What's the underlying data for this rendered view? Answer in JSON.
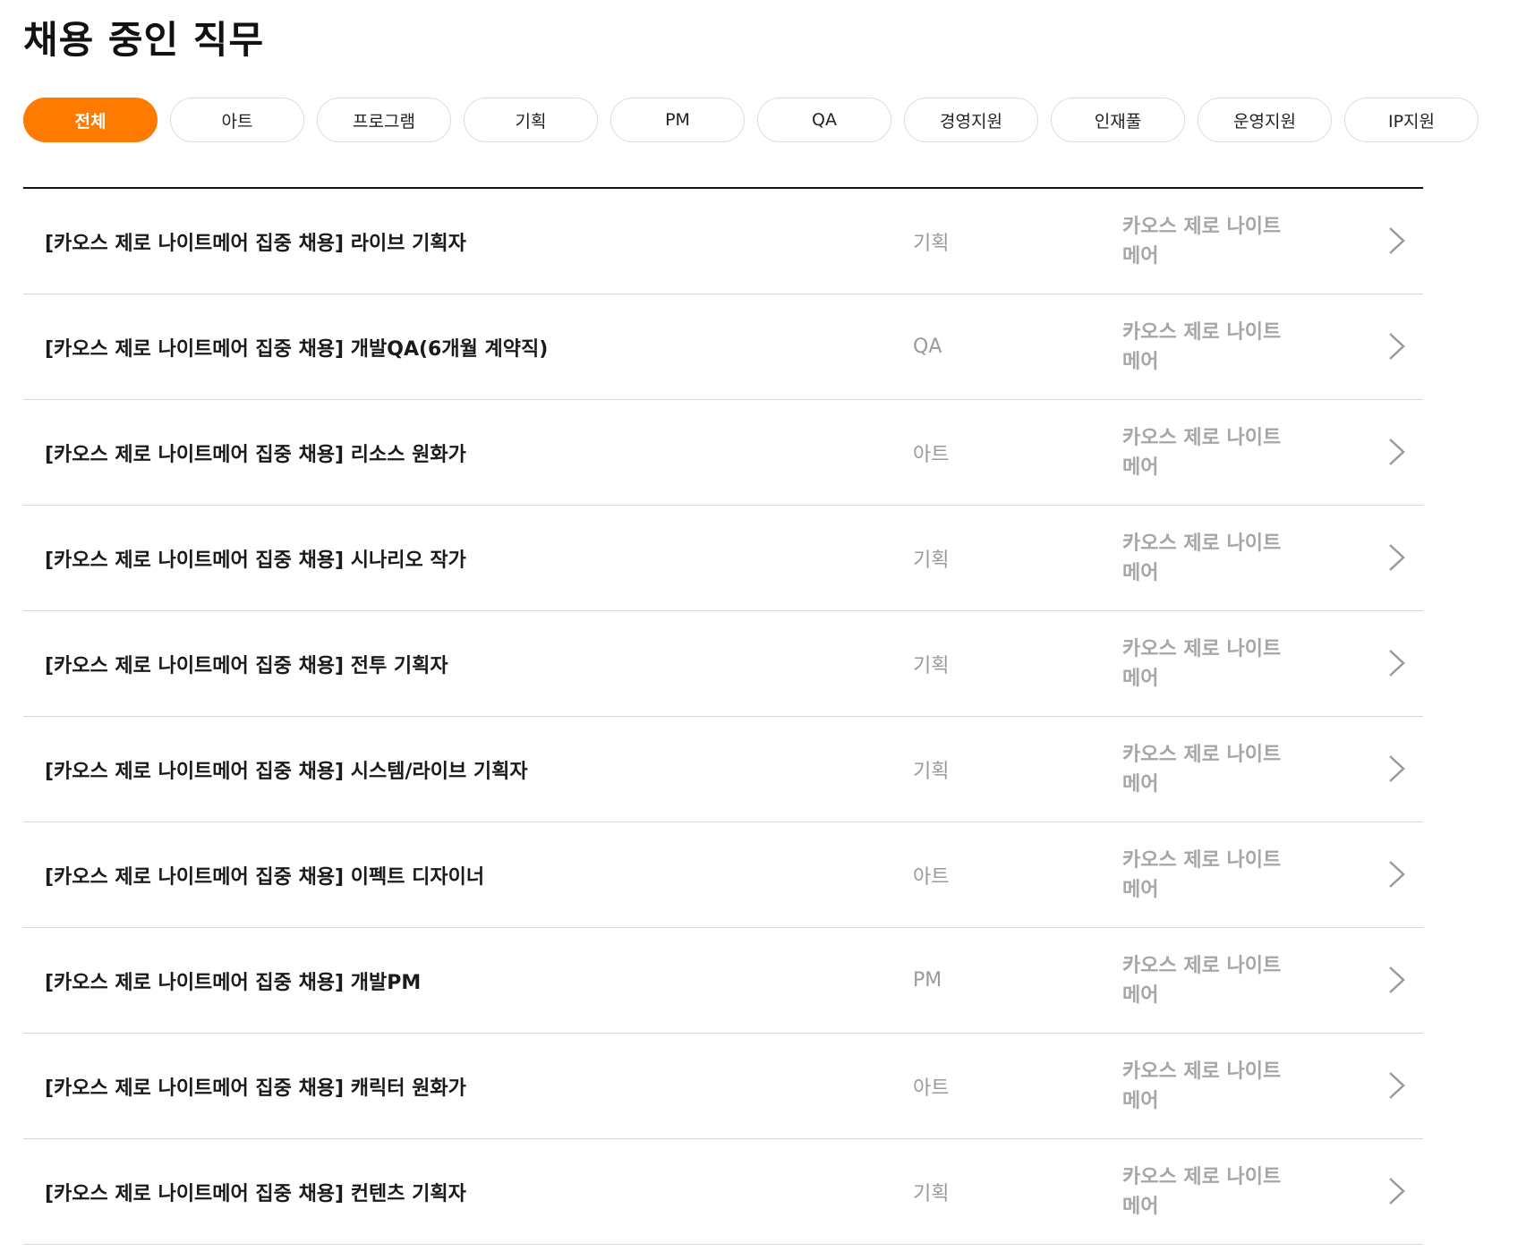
{
  "page": {
    "title": "채용 중인 직무"
  },
  "tabs": [
    {
      "label": "전체",
      "active": true
    },
    {
      "label": "아트",
      "active": false
    },
    {
      "label": "프로그램",
      "active": false
    },
    {
      "label": "기획",
      "active": false
    },
    {
      "label": "PM",
      "active": false
    },
    {
      "label": "QA",
      "active": false
    },
    {
      "label": "경영지원",
      "active": false
    },
    {
      "label": "인재풀",
      "active": false
    },
    {
      "label": "운영지원",
      "active": false
    },
    {
      "label": "IP지원",
      "active": false
    }
  ],
  "jobs": [
    {
      "title": "[카오스 제로 나이트메어 집중 채용] 라이브 기획자",
      "category": "기획",
      "project": "카오스 제로 나이트메어"
    },
    {
      "title": "[카오스 제로 나이트메어 집중 채용] 개발QA(6개월 계약직)",
      "category": "QA",
      "project": "카오스 제로 나이트메어"
    },
    {
      "title": "[카오스 제로 나이트메어 집중 채용] 리소스 원화가",
      "category": "아트",
      "project": "카오스 제로 나이트메어"
    },
    {
      "title": "[카오스 제로 나이트메어 집중 채용] 시나리오 작가",
      "category": "기획",
      "project": "카오스 제로 나이트메어"
    },
    {
      "title": "[카오스 제로 나이트메어 집중 채용] 전투 기획자",
      "category": "기획",
      "project": "카오스 제로 나이트메어"
    },
    {
      "title": "[카오스 제로 나이트메어 집중 채용] 시스템/라이브 기획자",
      "category": "기획",
      "project": "카오스 제로 나이트메어"
    },
    {
      "title": "[카오스 제로 나이트메어 집중 채용] 이펙트 디자이너",
      "category": "아트",
      "project": "카오스 제로 나이트메어"
    },
    {
      "title": "[카오스 제로 나이트메어 집중 채용] 개발PM",
      "category": "PM",
      "project": "카오스 제로 나이트메어"
    },
    {
      "title": "[카오스 제로 나이트메어 집중 채용] 캐릭터 원화가",
      "category": "아트",
      "project": "카오스 제로 나이트메어"
    },
    {
      "title": "[카오스 제로 나이트메어 집중 채용] 컨텐츠 기획자",
      "category": "기획",
      "project": "카오스 제로 나이트메어"
    }
  ],
  "icons": {
    "row_arrow": "chevron-right-icon"
  },
  "colors": {
    "accent": "#ff7a00",
    "muted_text": "#9a9a9a",
    "divider": "#d6d6d6"
  }
}
